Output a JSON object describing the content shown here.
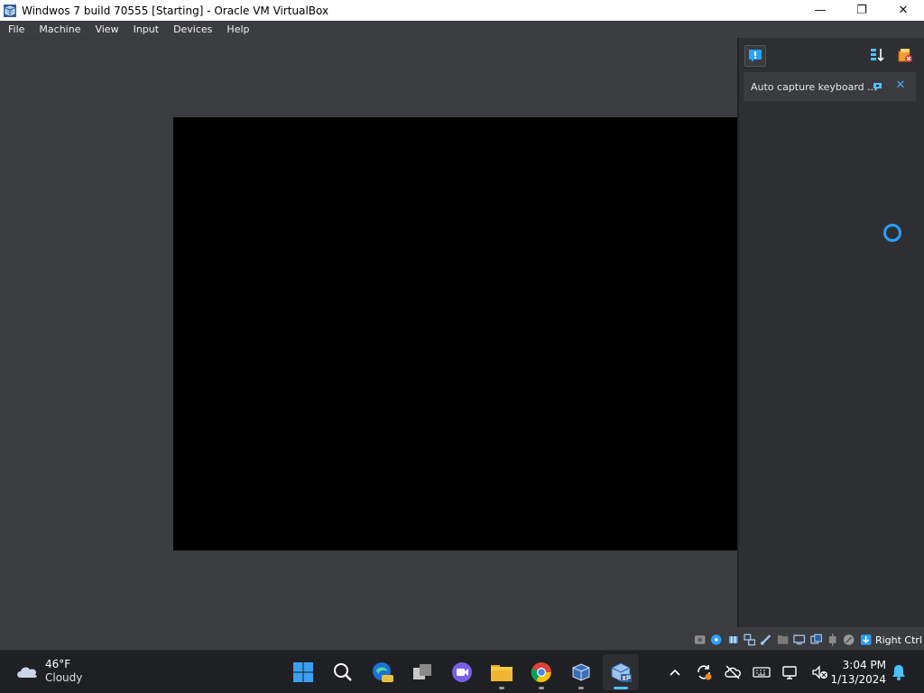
{
  "window": {
    "title": "Windwos 7 build 70555 [Starting] - Oracle VM VirtualBox",
    "icon": "virtualbox-icon",
    "controls": {
      "minimize": "—",
      "maximize": "❐",
      "close": "✕"
    }
  },
  "menu": {
    "items": [
      "File",
      "Machine",
      "View",
      "Input",
      "Devices",
      "Help"
    ]
  },
  "notification_center": {
    "card": {
      "text": "Auto capture keyboard ..."
    },
    "close_glyph": "✕"
  },
  "statusbar": {
    "host_key": "Right Ctrl"
  },
  "taskbar": {
    "weather": {
      "temp": "46°F",
      "condition": "Cloudy"
    },
    "clock": {
      "time": "3:04 PM",
      "date": "1/13/2024"
    },
    "apps": [
      "windows-start",
      "search",
      "edge-dev",
      "task-view",
      "clipchamp",
      "file-explorer",
      "chrome",
      "virtualbox",
      "virtualbox-vm-xp"
    ]
  },
  "colors": {
    "accent": "#4cc2ff",
    "spinner": "#2aa0ff",
    "vm_background": "#3b3c3f",
    "taskbar": "#1f2023"
  }
}
